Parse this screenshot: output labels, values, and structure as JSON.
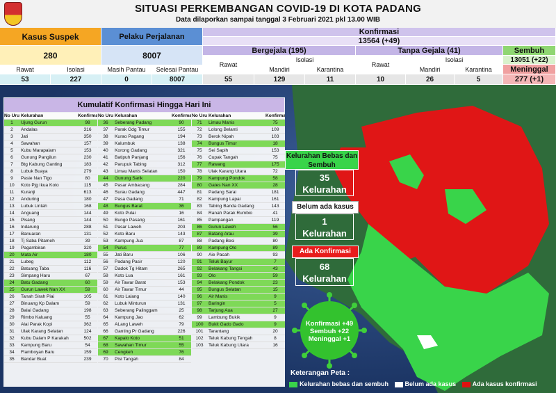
{
  "header": {
    "title": "SITUASI PERKEMBANGAN COVID-19 DI KOTA PADANG",
    "subtitle": "Data dilaporkan sampai tanggal 3 Februari 2021 pkl 13.00 WIB"
  },
  "stats": {
    "suspek": {
      "label": "Kasus Suspek",
      "value": "280",
      "rawat_label": "Rawat",
      "isolasi_label": "Isolasi",
      "rawat": "53",
      "isolasi": "227"
    },
    "pp": {
      "label": "Pelaku Perjalanan",
      "value": "8007",
      "pantau_label": "Masih Pantau",
      "selesai_label": "Selesai Pantau",
      "pantau": "0",
      "selesai": "8007"
    },
    "konfirmasi": {
      "label": "Konfirmasi",
      "value": "13564 (+49)"
    },
    "bergejala": {
      "label": "Bergejala (195)",
      "rawat_label": "Rawat",
      "isolasi_label": "Isolasi",
      "mandiri_label": "Mandiri",
      "karantina_label": "Karantina",
      "rawat": "55",
      "mandiri": "129",
      "karantina": "11"
    },
    "tanpa": {
      "label": "Tanpa Gejala (41)",
      "rawat_label": "Rawat",
      "isolasi_label": "Isolasi",
      "mandiri_label": "Mandiri",
      "karantina_label": "Karantina",
      "rawat": "10",
      "mandiri": "26",
      "karantina": "5"
    },
    "sembuh": {
      "label": "Sembuh",
      "value": "13051 (+22)"
    },
    "meninggal": {
      "label": "Meninggal",
      "value": "277 (+1)"
    }
  },
  "table": {
    "title": "Kumulatif Konfirmasi Hingga Hari Ini",
    "headers": {
      "no": "No Urut",
      "kel": "Kelurahan",
      "konf": "Konfirmasi"
    },
    "rows": [
      [
        "1",
        "Ujung Gurun",
        "98",
        1
      ],
      [
        "2",
        "Andalas",
        "316",
        0
      ],
      [
        "3",
        "Jati",
        "350",
        0
      ],
      [
        "4",
        "Sawahan",
        "157",
        0
      ],
      [
        "5",
        "Kubu Marapalam",
        "153",
        0
      ],
      [
        "6",
        "Gunung Pangilun",
        "230",
        0
      ],
      [
        "7",
        "Btg Kabung Ganting",
        "183",
        0
      ],
      [
        "8",
        "Lubuk Buaya",
        "279",
        0
      ],
      [
        "9",
        "Pasie Nan Tigo",
        "80",
        0
      ],
      [
        "10",
        "Koto Pjg Ikua Koto",
        "115",
        0
      ],
      [
        "11",
        "Kuranji",
        "613",
        0
      ],
      [
        "12",
        "Anduring",
        "180",
        0
      ],
      [
        "13",
        "Lubuk Lintah",
        "168",
        0
      ],
      [
        "14",
        "Anguang",
        "144",
        0
      ],
      [
        "15",
        "Pisang",
        "144",
        0
      ],
      [
        "16",
        "Indarung",
        "288",
        0
      ],
      [
        "17",
        "Banuaran",
        "131",
        0
      ],
      [
        "18",
        "Tj Saba Pitameh",
        "39",
        0
      ],
      [
        "19",
        "Pagambiran",
        "320",
        0
      ],
      [
        "20",
        "Mata Air",
        "180",
        1
      ],
      [
        "21",
        "Lubeg",
        "112",
        0
      ],
      [
        "22",
        "Batuang Taba",
        "116",
        0
      ],
      [
        "23",
        "Simpang Haru",
        "67",
        0
      ],
      [
        "24",
        "Batu Gadang",
        "60",
        1
      ],
      [
        "25",
        "Gurun Lawek Nan XX",
        "59",
        1
      ],
      [
        "26",
        "Tanah Sirah Piai",
        "105",
        0
      ],
      [
        "27",
        "Binuang Kp Dalam",
        "59",
        0
      ],
      [
        "28",
        "Balai Gadang",
        "198",
        0
      ],
      [
        "29",
        "Rimbo Kaluang",
        "55",
        0
      ],
      [
        "30",
        "Alai Parak Kopi",
        "362",
        0
      ],
      [
        "31",
        "Ulak Karang Selatan",
        "124",
        0
      ],
      [
        "32",
        "Kubu Dalam P Karakah",
        "502",
        0
      ],
      [
        "33",
        "Kampung Baru",
        "54",
        0
      ],
      [
        "34",
        "Flamboyan Baru",
        "159",
        0
      ],
      [
        "35",
        "Bandar Buat",
        "239",
        0
      ],
      [
        "36",
        "Seberang Padang",
        "90",
        1
      ],
      [
        "37",
        "Parak Gdg Timur",
        "155",
        0
      ],
      [
        "38",
        "Kurao Pagang",
        "194",
        0
      ],
      [
        "39",
        "Kalumbuk",
        "138",
        0
      ],
      [
        "40",
        "Korong Gadang",
        "321",
        0
      ],
      [
        "41",
        "Batipuh Panjang",
        "156",
        0
      ],
      [
        "42",
        "Parupuk Tabing",
        "312",
        0
      ],
      [
        "43",
        "Limau Manis Selatan",
        "150",
        0
      ],
      [
        "44",
        "Gunung Sarik",
        "220",
        1
      ],
      [
        "45",
        "Pasar Ambacang",
        "284",
        0
      ],
      [
        "46",
        "Surau Gadang",
        "447",
        0
      ],
      [
        "47",
        "Pasa Gadang",
        "71",
        0
      ],
      [
        "48",
        "Bungus Barat",
        "36",
        1
      ],
      [
        "49",
        "Koto Pulai",
        "16",
        0
      ],
      [
        "50",
        "Bungo Pasang",
        "161",
        0
      ],
      [
        "51",
        "Pasar Laweh",
        "203",
        0
      ],
      [
        "52",
        "Koto Baru",
        "143",
        0
      ],
      [
        "53",
        "Kampung Jua",
        "87",
        0
      ],
      [
        "54",
        "Purus",
        "77",
        1
      ],
      [
        "55",
        "Jati Baru",
        "106",
        0
      ],
      [
        "56",
        "Padang Pasir",
        "120",
        0
      ],
      [
        "57",
        "Dadok Tg Hitam",
        "265",
        0
      ],
      [
        "58",
        "Koto Lua",
        "161",
        0
      ],
      [
        "59",
        "Air Tawar Barat",
        "153",
        0
      ],
      [
        "60",
        "Air Tawar Timur",
        "44",
        0
      ],
      [
        "61",
        "Koto Lalang",
        "140",
        0
      ],
      [
        "62",
        "Lubuk Minturun",
        "131",
        0
      ],
      [
        "63",
        "Seberang Palinggam",
        "25",
        0
      ],
      [
        "64",
        "Kampung Jao",
        "62",
        0
      ],
      [
        "65",
        "ALang Laweh",
        "79",
        0
      ],
      [
        "66",
        "Ganting Pr Gadang",
        "226",
        0
      ],
      [
        "67",
        "Kapalo Koto",
        "51",
        1
      ],
      [
        "68",
        "Sawahan Timur",
        "55",
        1
      ],
      [
        "69",
        "Cengkeh",
        "76",
        1
      ],
      [
        "70",
        "Pisi Tangah",
        "84",
        0
      ],
      [
        "71",
        "Limau Manis",
        "75",
        1
      ],
      [
        "72",
        "Lolong Belanti",
        "109",
        0
      ],
      [
        "73",
        "Berok Nipah",
        "103",
        0
      ],
      [
        "74",
        "Bungus Timur",
        "18",
        1
      ],
      [
        "75",
        "Sei Sapih",
        "153",
        0
      ],
      [
        "76",
        "Cupak Tangah",
        "75",
        0
      ],
      [
        "77",
        "Rawang",
        "175",
        1
      ],
      [
        "78",
        "Ulak Karang Utara",
        "72",
        0
      ],
      [
        "79",
        "Kampung Pondok",
        "58",
        1
      ],
      [
        "80",
        "Gates Nan XX",
        "28",
        1
      ],
      [
        "81",
        "Padang Sarai",
        "181",
        0
      ],
      [
        "82",
        "Kampung Lapai",
        "161",
        0
      ],
      [
        "83",
        "Tabing Banda Gadang",
        "143",
        0
      ],
      [
        "84",
        "Ranah Parak Rumbio",
        "41",
        0
      ],
      [
        "85",
        "Pampangan",
        "119",
        0
      ],
      [
        "86",
        "Gurun Laweh",
        "56",
        1
      ],
      [
        "87",
        "Batang Arau",
        "39",
        1
      ],
      [
        "88",
        "Padang Besi",
        "80",
        0
      ],
      [
        "89",
        "Kampung Olo",
        "89",
        1
      ],
      [
        "90",
        "Aie Pacah",
        "93",
        0
      ],
      [
        "91",
        "Teluk Bayur",
        "7",
        1
      ],
      [
        "92",
        "Belakang Tangsi",
        "43",
        1
      ],
      [
        "93",
        "Olo",
        "59",
        1
      ],
      [
        "94",
        "Belakang Pondok",
        "23",
        1
      ],
      [
        "95",
        "Bungus Selatan",
        "15",
        1
      ],
      [
        "96",
        "Air Manis",
        "9",
        1
      ],
      [
        "97",
        "Baringin",
        "5",
        1
      ],
      [
        "98",
        "Tarjung Aua",
        "27",
        1
      ],
      [
        "99",
        "Lambung Bukik",
        "9",
        0
      ],
      [
        "100",
        "Bukit Gado Gado",
        "9",
        1
      ],
      [
        "101",
        "Tarantang",
        "20",
        0
      ],
      [
        "102",
        "Teluk Kabung Tengah",
        "8",
        0
      ],
      [
        "103",
        "Teluk Kabung Utara",
        "16",
        0
      ]
    ]
  },
  "boxes": {
    "bebas_title": "Kelurahan Bebas dan Sembuh",
    "bebas_count": "35",
    "bebas_unit": "Kelurahan",
    "belum_title": "Belum ada kasus",
    "belum_count": "1",
    "belum_unit": "Kelurahan",
    "ada_title": "Ada Konfirmasi",
    "ada_count": "68",
    "ada_unit": "Kelurahan",
    "virus_l1": "Konfirmasi +49",
    "virus_l2": "Sembuh +22",
    "virus_l3": "Meninggal +1"
  },
  "legend": {
    "title": "Keterangan Peta :",
    "g": "Kelurahan bebas dan sembuh",
    "w": "Belum ada kasus",
    "r": "Ada kasus konfirmasi",
    "colors": {
      "green": "#39d44a",
      "white": "#ffffff",
      "red": "#e01010"
    }
  }
}
